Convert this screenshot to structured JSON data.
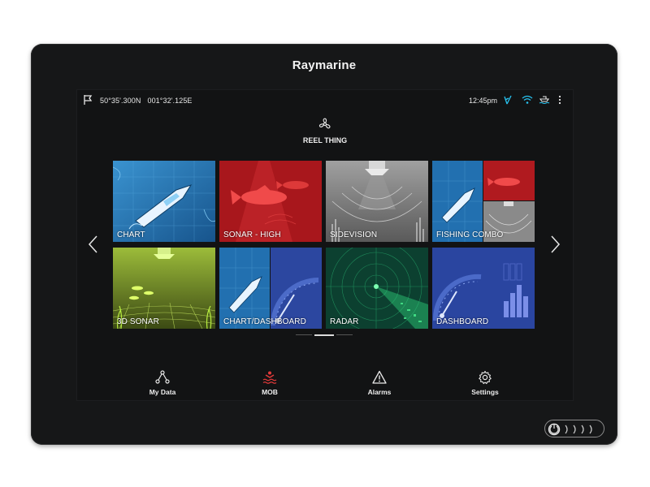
{
  "device": {
    "brand": "Raymarine"
  },
  "status": {
    "latitude": "50°35'.300N",
    "longitude": "001°32'.125E",
    "time": "12:45pm",
    "icons": [
      "flag-icon",
      "gps-icon",
      "wifi-icon",
      "boat-icon",
      "more-icon"
    ]
  },
  "profile": {
    "name": "REEL THING",
    "icon": "propeller-icon"
  },
  "apps": [
    {
      "label": "CHART"
    },
    {
      "label": "SONAR - HIGH"
    },
    {
      "label": "SIDEVISION"
    },
    {
      "label": "FISHING COMBO"
    },
    {
      "label": "3D SONAR"
    },
    {
      "label": "CHART/DASHBOARD"
    },
    {
      "label": "RADAR"
    },
    {
      "label": "DASHBOARD"
    }
  ],
  "pager": {
    "pages": 3,
    "active_page": 2
  },
  "nav": {
    "my_data": "My Data",
    "mob": "MOB",
    "alarms": "Alarms",
    "settings": "Settings"
  },
  "colors": {
    "chart_blue": "#2a7ab8",
    "sonar_red": "#b8191f",
    "sidevision_gray": "#8a8a8a",
    "sonar3d_green": "#8aa92c",
    "radar_green": "#0f5a3a",
    "dashboard_blue": "#2d4a9e",
    "mob_red": "#e33a3a",
    "accent_cyan": "#28c3f0"
  }
}
